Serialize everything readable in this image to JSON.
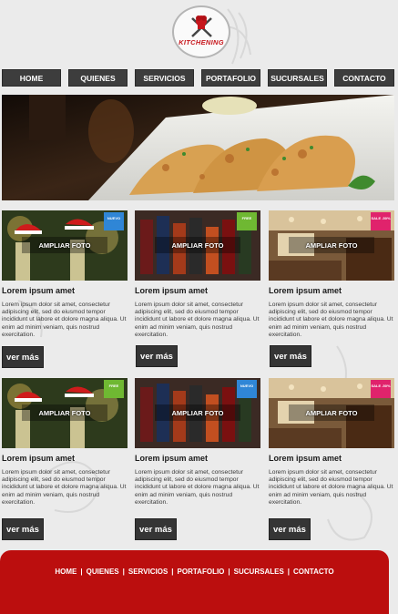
{
  "brand": {
    "logo_text": "KITCHENING"
  },
  "nav": {
    "items": [
      "HOME",
      "QUIENES",
      "SERVICIOS",
      "PORTAFOLIO",
      "SUCURSALES",
      "CONTACTO"
    ]
  },
  "hero": {
    "alt": "hero-food-photo"
  },
  "cards": [
    {
      "overlay": "AMPLIAR FOTO",
      "title": "Lorem ipsum amet",
      "text": "Lorem ipsum dolor sit amet, consectetur adipiscing elit, sed do eiusmod tempor incididunt ut labore et dolore magna aliqua. Ut enim ad minim veniam, quis nostrud exercitation.",
      "button": "ver más",
      "ribbon": "NUEVO",
      "ribbon_color": "#2f86d6",
      "photo": "christmas-champagne"
    },
    {
      "overlay": "AMPLIAR FOTO",
      "title": "Lorem ipsum amet",
      "text": "Lorem ipsum dolor sit amet, consectetur adipiscing elit, sed do eiusmod tempor incididunt ut labore et dolore magna aliqua. Ut enim ad minim veniam, quis nostrud exercitation.",
      "button": "ver más",
      "ribbon": "FREE",
      "ribbon_color": "#6fb832",
      "photo": "bottles-bar"
    },
    {
      "overlay": "AMPLIAR FOTO",
      "title": "Lorem ipsum amet",
      "text": "Lorem ipsum dolor sit amet, consectetur adipiscing elit, sed do eiusmod tempor incididunt ut labore et dolore magna aliqua. Ut enim ad minim veniam, quis nostrud exercitation.",
      "button": "ver más",
      "ribbon": "SALE -50%",
      "ribbon_color": "#e0236c",
      "photo": "restaurant-interior"
    },
    {
      "overlay": "AMPLIAR FOTO",
      "title": "Lorem ipsum amet",
      "text": "Lorem ipsum dolor sit amet, consectetur adipiscing elit, sed do eiusmod tempor incididunt ut labore et dolore magna aliqua. Ut enim ad minim veniam, quis nostrud exercitation.",
      "button": "ver más",
      "ribbon": "FREE",
      "ribbon_color": "#6fb832",
      "photo": "christmas-champagne"
    },
    {
      "overlay": "AMPLIAR FOTO",
      "title": "Lorem ipsum amet",
      "text": "Lorem ipsum dolor sit amet, consectetur adipiscing elit, sed do eiusmod tempor incididunt ut labore et dolore magna aliqua. Ut enim ad minim veniam, quis nostrud exercitation.",
      "button": "ver más",
      "ribbon": "NUEVO",
      "ribbon_color": "#2f86d6",
      "photo": "bottles-bar"
    },
    {
      "overlay": "AMPLIAR FOTO",
      "title": "Lorem ipsum amet",
      "text": "Lorem ipsum dolor sit amet, consectetur adipiscing elit, sed do eiusmod tempor incididunt ut labore et dolore magna aliqua. Ut enim ad minim veniam, quis nostrud exercitation.",
      "button": "ver más",
      "ribbon": "SALE -50%",
      "ribbon_color": "#e0236c",
      "photo": "restaurant-interior"
    }
  ],
  "footer": {
    "links": [
      "HOME",
      "QUIENES",
      "SERVICIOS",
      "PORTAFOLIO",
      "SUCURSALES",
      "CONTACTO"
    ],
    "separator": "|"
  },
  "colors": {
    "nav_bg": "#3d3d3d",
    "footer_bg": "#bb0e0e",
    "brand_red": "#c7161c",
    "button_bg": "#353535"
  }
}
